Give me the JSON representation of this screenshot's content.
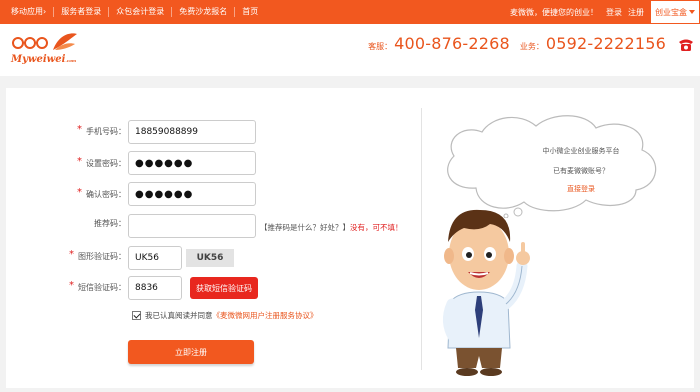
{
  "topbar": {
    "nav": [
      "移动应用",
      "服务者登录",
      "众包会计登录",
      "免费沙龙报名",
      "首页"
    ],
    "greeting": "麦微微，便捷您的创业！",
    "login": "登录",
    "register": "注册",
    "treasure": "创业宝盒"
  },
  "header": {
    "logo_text": "Myweiwei",
    "logo_suffix": ".com",
    "service_label": "客服：",
    "service_phone": "400-876-2268",
    "business_label": "业务：",
    "business_phone": "0592-2222156"
  },
  "form": {
    "phone_label": "手机号码：",
    "phone_value": "18859088899",
    "password_label": "设置密码：",
    "password_value": "●●●●●●",
    "confirm_label": "确认密码：",
    "confirm_value": "●●●●●●",
    "referrer_label": "推荐码：",
    "referrer_value": "",
    "referrer_hint_prefix": "【推荐码是什么？好处？】",
    "referrer_hint_red": "没有，可不填！",
    "captcha_label": "图形验证码：",
    "captcha_value": "UK56",
    "captcha_image_text": "UK56",
    "sms_label": "短信验证码：",
    "sms_value": "8836",
    "sms_button": "获取短信验证码",
    "agree_text": "我已认真阅读并同意",
    "agree_link": "《麦微微网用户注册服务协议》",
    "submit": "立即注册"
  },
  "side": {
    "line1": "中小微企业创业服务平台",
    "line2": "已有麦微微账号？",
    "login_link": "直接登录"
  },
  "colors": {
    "brand_orange": "#f2581f",
    "red_button": "#e8271e"
  }
}
